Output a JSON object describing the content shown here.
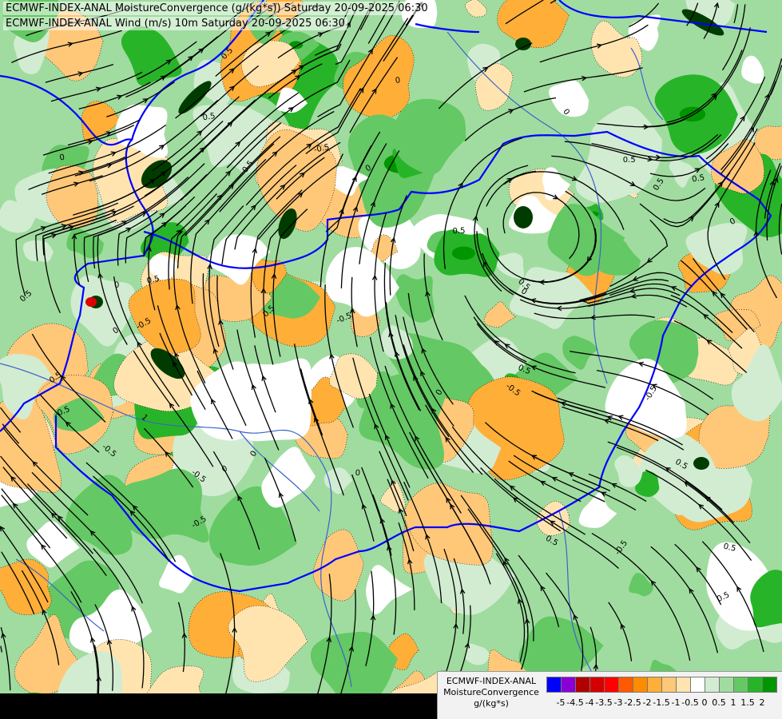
{
  "titles": {
    "line1": "ECMWF-INDEX-ANAL MoistureConvergence (g/(kg*s)) Saturday 20-09-2025 06:30",
    "line2": "ECMWF-INDEX-ANAL Wind (m/s) 10m Saturday 20-09-2025 06:30"
  },
  "legend": {
    "label_line1": "ECMWF-INDEX-ANAL",
    "label_line2": "MoistureConvergence",
    "label_line3": "g/(kg*s)",
    "colors": [
      "#0000ff",
      "#8a00d4",
      "#b00000",
      "#d40000",
      "#ff0000",
      "#ff5a00",
      "#ff8c00",
      "#ffae38",
      "#ffc878",
      "#ffe4b0",
      "#ffffff",
      "#d2ecd2",
      "#a0dca0",
      "#64c864",
      "#28b428",
      "#009600"
    ],
    "ticks": [
      "-5",
      "-4.5",
      "-4",
      "-3.5",
      "-3",
      "-2.5",
      "-2",
      "-1.5",
      "-1",
      "-0.5",
      "0",
      "0.5",
      "1",
      "1.5",
      "2"
    ]
  },
  "map": {
    "contour_labels": [
      "0",
      "0.5",
      "-0.5",
      "0.5",
      "0",
      "-0.5",
      "0.5",
      "0",
      "0.5",
      "-0.5",
      "0",
      "0.5",
      "0.5",
      "-0.5",
      "0",
      "0.5",
      "1",
      "0.5",
      "-0.5",
      "0",
      "0.5",
      "0",
      "-0.5",
      "0.5",
      "0",
      "0.5",
      "-0.5",
      "0.5",
      "0",
      "0.5",
      "0.5",
      "-0.5",
      "0",
      "0.5",
      "-0.5",
      "0",
      "0.5",
      "0",
      "-0.5",
      "0.5"
    ],
    "colors": {
      "border": "#0000ff",
      "river": "#3c64c8",
      "streamline": "#000000"
    }
  }
}
